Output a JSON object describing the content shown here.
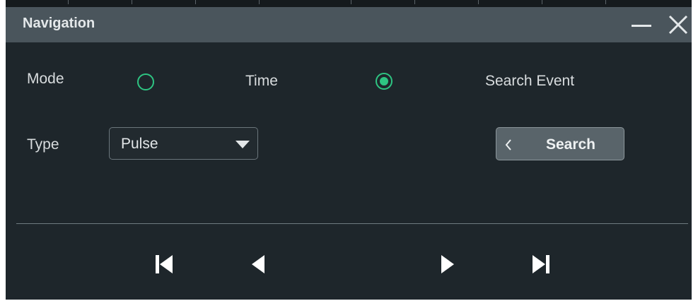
{
  "window": {
    "title": "Navigation"
  },
  "mode": {
    "label": "Mode",
    "options": [
      {
        "label": "Time",
        "selected": false
      },
      {
        "label": "Search Event",
        "selected": true
      }
    ]
  },
  "type": {
    "label": "Type",
    "value": "Pulse"
  },
  "search_button": {
    "label": "Search"
  },
  "colors": {
    "accent": "#2ec482",
    "dialog_bg": "#1e262b",
    "titlebar_bg": "#4a555c",
    "button_bg": "#59646a"
  },
  "icons": {
    "minimize": "minimize-icon",
    "close": "close-icon",
    "dropdown": "caret-down-icon",
    "search_chevron": "chevron-left-icon",
    "first": "skip-to-first-icon",
    "previous": "previous-icon",
    "next": "next-icon",
    "last": "skip-to-last-icon"
  }
}
